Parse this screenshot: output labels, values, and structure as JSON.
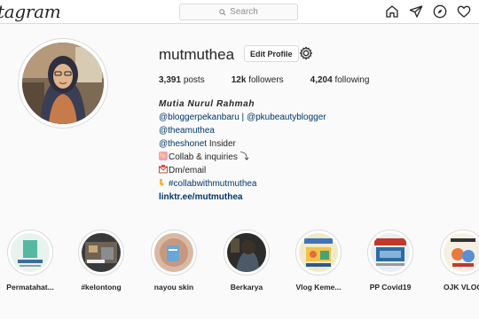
{
  "header": {
    "logo": "Instagram",
    "search_placeholder": "Search",
    "icons": [
      "home-icon",
      "direct-message-icon",
      "explore-compass-icon",
      "activity-heart-icon"
    ]
  },
  "profile": {
    "username": "mutmuthea",
    "edit_label": "Edit Profile",
    "options_icon": "settings-gear-icon",
    "stats": {
      "posts": "3,391",
      "posts_label": "posts",
      "followers": "12k",
      "followers_label": "followers",
      "following": "4,204",
      "following_label": "following"
    },
    "bio": {
      "name": "Mutia Nurul Rahmah",
      "mention1": "@bloggerpekanbaru",
      "separator": " | ",
      "mention2": "@pkubeautyblogger",
      "mention3": "@theamuthea",
      "mention4": "@theshonet",
      "mention4_suffix": " Insider",
      "collab": "Collab & inquiries ⤵",
      "dm": "Dm/email",
      "hashtag": "#collabwithmutmuthea",
      "website": "linktr.ee/mutmuthea"
    }
  },
  "highlights": [
    {
      "label": "Permatahat..."
    },
    {
      "label": "#kelontong"
    },
    {
      "label": "nayou skin"
    },
    {
      "label": "Berkarya"
    },
    {
      "label": "Vlog Keme..."
    },
    {
      "label": "PP Covid19"
    },
    {
      "label": "OJK VLOG"
    }
  ],
  "colors": {
    "link": "#00376b",
    "text": "#262626",
    "border": "#dbdbdb",
    "muted": "#8e8e8e"
  }
}
